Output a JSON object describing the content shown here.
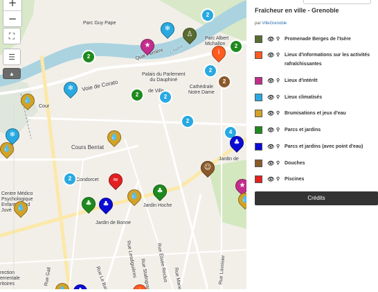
{
  "map": {
    "zoom_in": "+",
    "zoom_out": "−",
    "labels": {
      "parc_guy_pape": "Parc Guy Pape",
      "quai_perriere": "Quai Perrière",
      "isere": "L'Isère",
      "parc_albert_michallon": "Parc Albert\nMichallon",
      "voie_corato": "Voie de Corato",
      "palais": "Palais du Parlement\ndu Dauphiné",
      "cathedrale": "Cathédrale\nNotre Dame",
      "de_ville": "de Ville",
      "cour": "Cour",
      "cours_berriat": "Cours Berriat",
      "condorcet": "Condorcet",
      "jardin_hoche": "Jardin Hoche",
      "jardin_bonne": "Jardin de Bonne",
      "jardin_de": "Jardin de",
      "centre_medico": "Centre Médico\nPsychologique\nEnfants et ad\nJuvé",
      "rue_lesdiguieres": "Rue Lesdiguières",
      "rue_stalingrad": "Rue Stalingrad",
      "rue_elisee": "Rue Élisée Reclus",
      "rue_lavoisier": "Rue Lavoisier",
      "rue_le_bas": "Rue Le Bas",
      "rue_marie": "Rue Marie",
      "rue_gall": "Rue Gall",
      "rection": "rection\nementale\nritoires"
    },
    "clusters": [
      "2",
      "2",
      "2",
      "2",
      "2",
      "2",
      "2",
      "2",
      "4",
      "2"
    ]
  },
  "panel": {
    "title": "Fraîcheur en ville - Grenoble",
    "author_prefix": "par ",
    "author_link": "VilleGrenoble",
    "layers": [
      {
        "label": "Promenade Berges de l'Isère",
        "color": "#5a6b30"
      },
      {
        "label": "Lieux d'informations sur les activités rafraîchissantes",
        "color": "#ff5a1f"
      },
      {
        "label": "Lieux d'intérêt",
        "color": "#c32d8c"
      },
      {
        "label": "Lieux climatisés",
        "color": "#29a9e1"
      },
      {
        "label": "Brumisations et jeux d'eau",
        "color": "#d4a227"
      },
      {
        "label": "Parcs et jardins",
        "color": "#1e8a1e"
      },
      {
        "label": "Parcs et jardins (avec point d'eau)",
        "color": "#0b0bd6"
      },
      {
        "label": "Douches",
        "color": "#8b5a2b"
      },
      {
        "label": "Piscines",
        "color": "#e32020"
      }
    ],
    "credits_label": "Crédits",
    "icons": {
      "visibility": "eye-icon",
      "zoom_to": "magnifier-icon"
    }
  }
}
